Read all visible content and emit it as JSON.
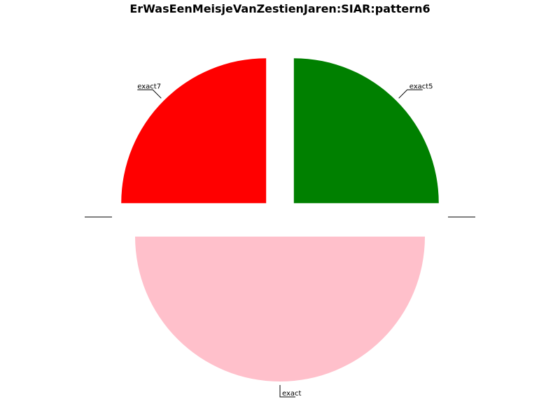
{
  "chart_data": {
    "type": "pie",
    "title": "ErWasEenMeisjeVanZestienJaren:SIAR:pattern6",
    "slices": [
      {
        "label": "exact5",
        "value": 25,
        "color": "#008000"
      },
      {
        "label": "",
        "value": 0,
        "color": "#008000"
      },
      {
        "label": "exact",
        "value": 50,
        "color": "#ffc0cb"
      },
      {
        "label": "",
        "value": 0,
        "color": "#ffc0cb"
      },
      {
        "label": "exact7",
        "value": 25,
        "color": "#ff0000"
      }
    ],
    "legend": "none"
  }
}
